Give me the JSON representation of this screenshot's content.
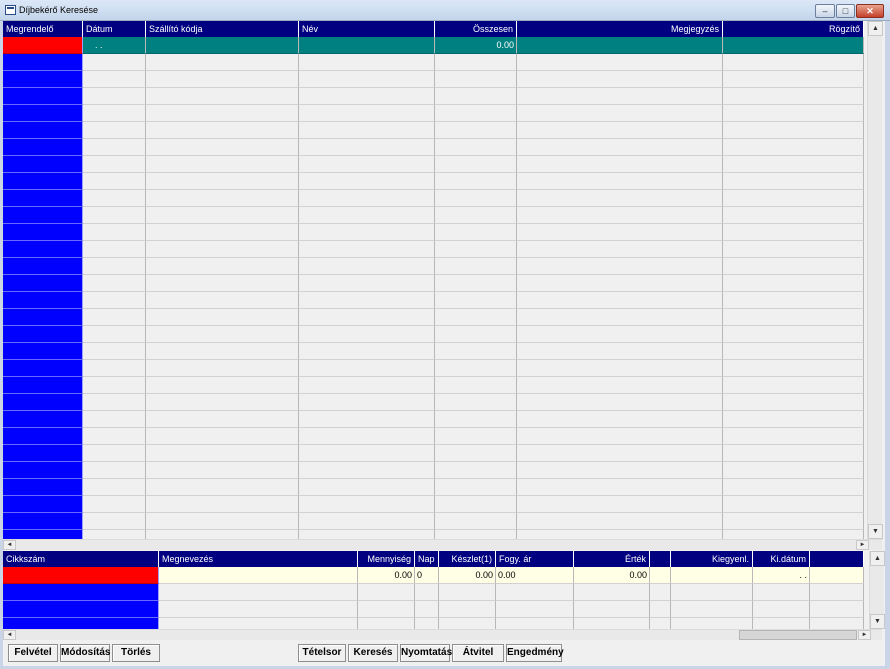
{
  "window": {
    "title": "Díjbekérő Keresése",
    "buttons": {
      "minimize": "–",
      "maximize": "□",
      "close": "✕"
    }
  },
  "top_grid": {
    "columns": [
      {
        "label": "Megrendelő",
        "align": "left"
      },
      {
        "label": "Dátum",
        "align": "left"
      },
      {
        "label": "Szállító kódja",
        "align": "left"
      },
      {
        "label": "Név",
        "align": "left"
      },
      {
        "label": "Összesen",
        "align": "right"
      },
      {
        "label": "Megjegyzés",
        "align": "right"
      },
      {
        "label": "Rögzítő",
        "align": "right"
      }
    ],
    "rows": [
      [
        "",
        ". .",
        "",
        "",
        "0.00",
        "",
        ""
      ]
    ],
    "empty_rows": 29
  },
  "bottom_grid": {
    "columns": [
      {
        "label": "Cikkszám",
        "align": "left"
      },
      {
        "label": "Megnevezés",
        "align": "left"
      },
      {
        "label": "Mennyiség",
        "align": "right"
      },
      {
        "label": "Nap",
        "align": "left"
      },
      {
        "label": "Készlet(1)",
        "align": "right"
      },
      {
        "label": "Fogy. ár",
        "align": "left"
      },
      {
        "label": "Érték",
        "align": "right"
      },
      {
        "label": "",
        "align": "left"
      },
      {
        "label": "Kiegyenl.",
        "align": "right"
      },
      {
        "label": "Ki.dátum",
        "align": "right"
      },
      {
        "label": "",
        "align": "left"
      }
    ],
    "rows": [
      [
        "",
        "",
        "0.00",
        "0",
        "0.00",
        "0.00",
        "0.00",
        "",
        "",
        ". .",
        ""
      ]
    ],
    "empty_rows": 3
  },
  "toolbar": {
    "felvetel": "Felvétel",
    "modositas": "Módosítás",
    "torles": "Törlés",
    "tetelsor": "Tételsor",
    "kereses": "Keresés",
    "nyomtatas": "Nyomtatás",
    "atvitel": "Átvitel",
    "engedmeny": "Engedmény"
  },
  "colors": {
    "header": "#000080",
    "selector": "#0000ff",
    "current_selector": "#ff0000",
    "active_row": "#008080",
    "detail_row": "#ffffe6"
  },
  "icons": {
    "scroll_up": "▲",
    "scroll_down": "▼",
    "scroll_left": "◄",
    "scroll_right": "►"
  }
}
